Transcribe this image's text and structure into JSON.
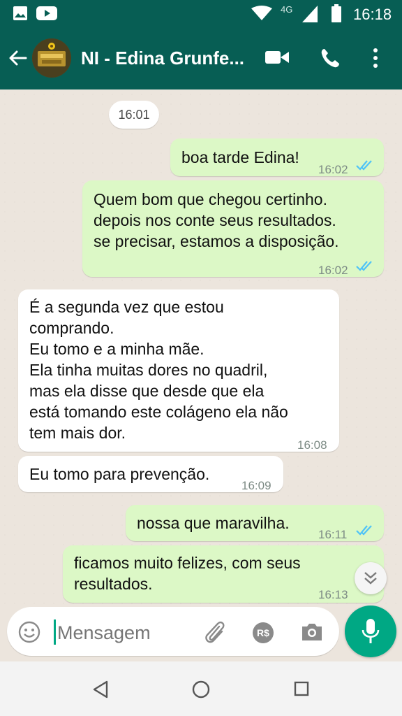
{
  "status_bar": {
    "time": "16:18",
    "network": "4G"
  },
  "header": {
    "contact_name": "NI - Edina Grunfe..."
  },
  "chat": {
    "date_chip": "16:01",
    "messages": [
      {
        "direction": "out",
        "text": "boa tarde Edina!",
        "time": "16:02",
        "read": true
      },
      {
        "direction": "out",
        "text": "Quem bom que chegou certinho.\ndepois nos conte seus resultados.\nse precisar, estamos a disposição.",
        "time": "16:02",
        "read": true
      },
      {
        "direction": "in",
        "text": "É a segunda vez que estou\ncomprando.\nEu tomo e a minha mãe.\nEla tinha muitas dores no quadril,\nmas ela disse que  desde que ela\nestá tomando este colágeno ela não\ntem mais dor.",
        "time": "16:08"
      },
      {
        "direction": "in",
        "text": "Eu tomo para prevenção.",
        "time": "16:09"
      },
      {
        "direction": "out",
        "text": "nossa que maravilha.",
        "time": "16:11",
        "read": true
      },
      {
        "direction": "out",
        "text": "ficamos muito felizes, com seus\nresultados.",
        "time": "16:13",
        "read": false
      }
    ]
  },
  "composer": {
    "placeholder": "Mensagem",
    "currency_label": "R$"
  },
  "colors": {
    "header": "#075e54",
    "accent": "#00a884",
    "outgoing_bubble": "#dcf8c6",
    "read_ticks": "#4fc3f7"
  }
}
